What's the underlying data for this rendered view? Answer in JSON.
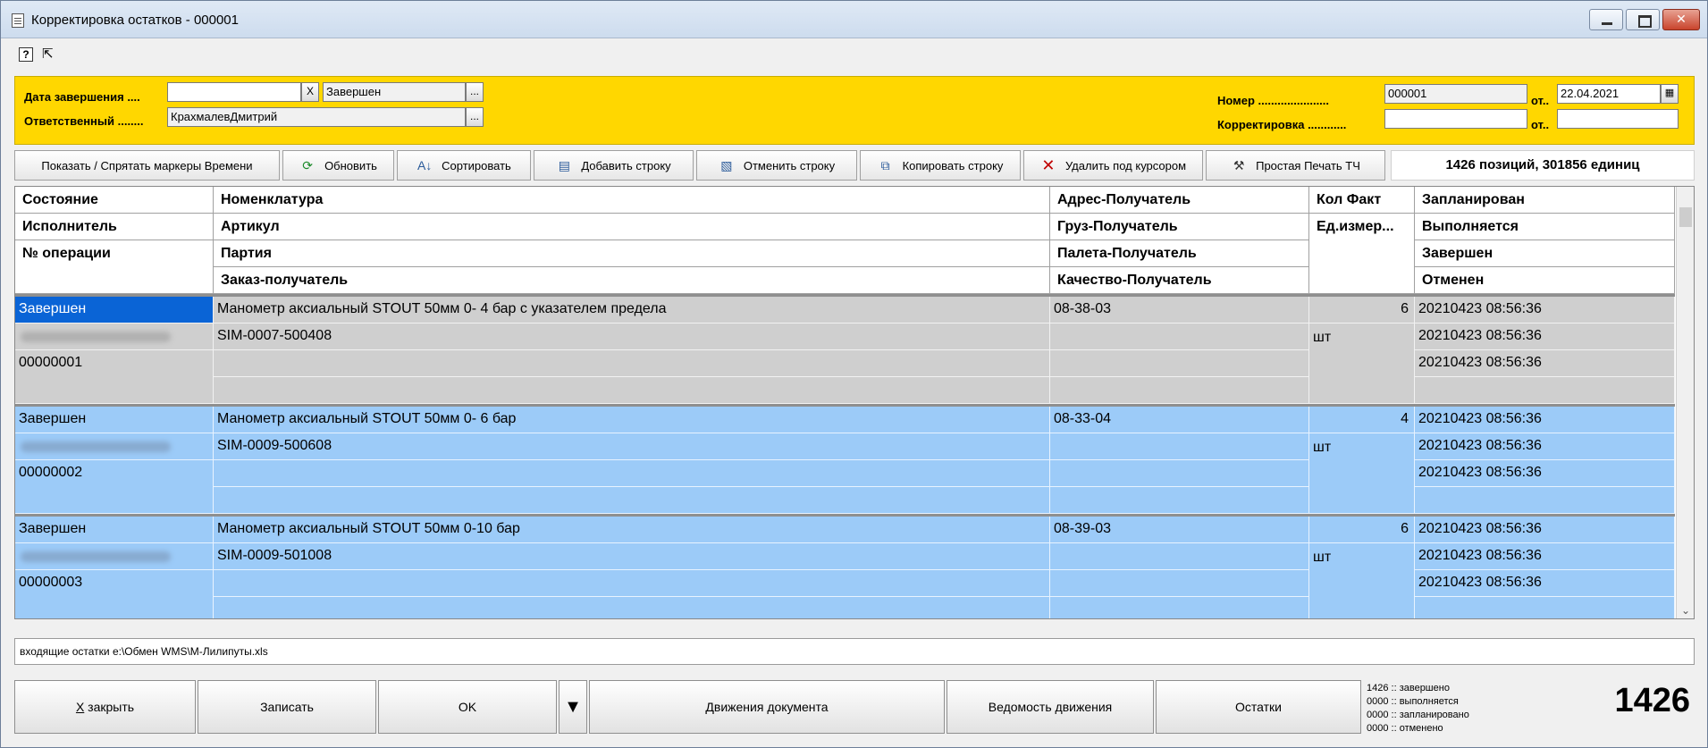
{
  "window": {
    "title": "Корректировка остатков - 000001"
  },
  "header": {
    "date_label": "Дата завершения ....",
    "date_value": "",
    "status_value": "Завершен",
    "responsible_label": "Ответственный ........",
    "responsible_value": "КрахмалевДмитрий",
    "number_label": "Номер ......................",
    "number_value": "000001",
    "from_label": "от..",
    "number_date": "22.04.2021",
    "correction_label": "Корректировка ............",
    "correction_value": "",
    "correction_from_label": "от..",
    "correction_date": "",
    "clear_glyph": "X",
    "browse_glyph": "..."
  },
  "toolbar": {
    "toggle_markers": "Показать / Спрятать маркеры Времени",
    "refresh": "Обновить",
    "sort": "Сортировать",
    "add_row": "Добавить строку",
    "cancel_row": "Отменить строку",
    "copy_row": "Копировать строку",
    "delete_row": "Удалить под курсором",
    "print": "Простая Печать ТЧ",
    "summary": "1426 позиций, 301856 единиц"
  },
  "grid": {
    "headers": {
      "c1": [
        "Состояние",
        "Исполнитель",
        "№ операции"
      ],
      "c2": [
        "Номенклатура",
        "Артикул",
        "Партия",
        "Заказ-получатель"
      ],
      "c3": [
        "Адрес-Получатель",
        "Груз-Получатель",
        "Палета-Получатель",
        "Качество-Получатель"
      ],
      "c4": [
        "Кол Факт",
        "Ед.измер..."
      ],
      "c5": [
        "Запланирован",
        "Выполняется",
        "Завершен",
        "Отменен"
      ]
    },
    "rows": [
      {
        "state": "Завершен",
        "executor": "",
        "operation": "00000001",
        "name": "Манометр аксиальный STOUT 50мм 0- 4 бар с указателем предела",
        "article": "SIM-0007-500408",
        "batch": "",
        "order": "",
        "address": "08-38-03",
        "cargo": "",
        "pallet": "",
        "quality": "",
        "qty": "6",
        "unit": "шт",
        "planned": "20210423 08:56:36",
        "executing": "20210423 08:56:36",
        "done": "20210423 08:56:36",
        "cancelled": ""
      },
      {
        "state": "Завершен",
        "executor": "",
        "operation": "00000002",
        "name": "Манометр аксиальный STOUT 50мм 0- 6 бар",
        "article": "SIM-0009-500608",
        "batch": "",
        "order": "",
        "address": "08-33-04",
        "cargo": "",
        "pallet": "",
        "quality": "",
        "qty": "4",
        "unit": "шт",
        "planned": "20210423 08:56:36",
        "executing": "20210423 08:56:36",
        "done": "20210423 08:56:36",
        "cancelled": ""
      },
      {
        "state": "Завершен",
        "executor": "",
        "operation": "00000003",
        "name": "Манометр аксиальный STOUT 50мм 0-10 бар",
        "article": "SIM-0009-501008",
        "batch": "",
        "order": "",
        "address": "08-39-03",
        "cargo": "",
        "pallet": "",
        "quality": "",
        "qty": "6",
        "unit": "шт",
        "planned": "20210423 08:56:36",
        "executing": "20210423 08:56:36",
        "done": "20210423 08:56:36",
        "cancelled": ""
      }
    ]
  },
  "comment": "входящие остатки e:\\Обмен WMS\\М-Лилипуты.xls",
  "footer": {
    "close": "закрыть",
    "close_hotkey": "Х",
    "save": "Записать",
    "ok": "OK",
    "movements": "Движения документа",
    "movement_report": "Ведомость движения",
    "balances": "Остатки",
    "stats": [
      "1426 :: завершено",
      "0000 :: выполняется",
      "0000 :: запланировано",
      "0000 :: отменено"
    ],
    "count": "1426"
  },
  "colors": {
    "header_bg": "#ffd700",
    "row_selected": "#0a64d6",
    "row_blue": "#9ccbf8",
    "row_gray": "#cfcfcf"
  }
}
